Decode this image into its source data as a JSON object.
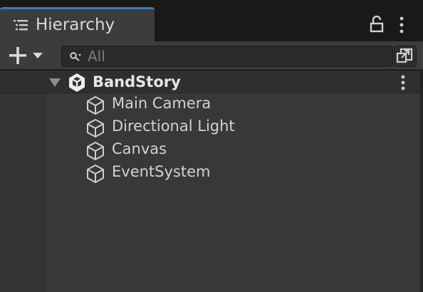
{
  "window": {
    "tab_title": "Hierarchy",
    "tab_icon": "list-icon",
    "lock_icon": "lock-icon",
    "menu_icon": "kebab-menu-icon"
  },
  "toolbar": {
    "create_icon": "plus-icon",
    "create_dropdown_icon": "caret-down-icon",
    "search_placeholder": "All",
    "search_value": "",
    "search_icon": "search-icon",
    "scene_visibility_icon": "scene-visibility-icon"
  },
  "scene": {
    "name": "BandStory",
    "icon": "unity-logo-icon",
    "expanded": true,
    "items": [
      {
        "label": "Main Camera",
        "icon": "gameobject-cube-icon"
      },
      {
        "label": "Directional Light",
        "icon": "gameobject-cube-icon"
      },
      {
        "label": "Canvas",
        "icon": "gameobject-cube-icon"
      },
      {
        "label": "EventSystem",
        "icon": "gameobject-cube-icon"
      }
    ]
  },
  "colors": {
    "tab_accent": "#3a79bb",
    "panel_bg": "#383838",
    "toolbar_bg": "#3c3c3c",
    "text": "#d2d2d2"
  }
}
